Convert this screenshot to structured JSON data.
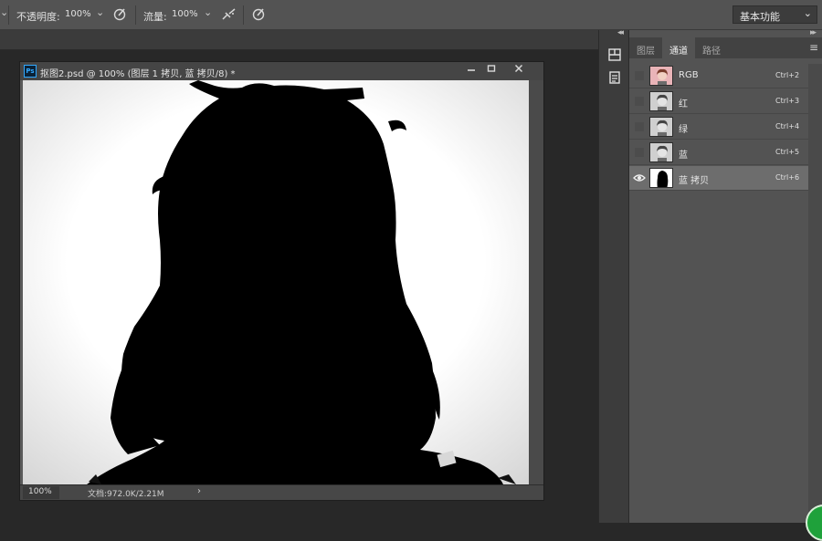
{
  "options": {
    "opacity_label": "不透明度:",
    "opacity_value": "100%",
    "flow_label": "流量:",
    "flow_value": "100%",
    "workspace": "基本功能"
  },
  "document": {
    "title": "抠图2.psd @ 100% (图层 1 拷贝, 蓝 拷贝/8) *",
    "app_icon": "Ps",
    "minimize_icon": "minimize-icon",
    "maximize_icon": "maximize-icon",
    "close_icon": "close-icon",
    "zoom": "100%",
    "doc_info": "文档:972.0K/2.21M",
    "more_icon": "›"
  },
  "panel": {
    "tabs": [
      "图层",
      "通道",
      "路径"
    ],
    "active_tab": "通道",
    "channels": [
      {
        "name": "RGB",
        "shortcut": "Ctrl+2",
        "visible": false,
        "selected": false,
        "thumb": "color"
      },
      {
        "name": "红",
        "shortcut": "Ctrl+3",
        "visible": false,
        "selected": false,
        "thumb": "gray"
      },
      {
        "name": "绿",
        "shortcut": "Ctrl+4",
        "visible": false,
        "selected": false,
        "thumb": "gray"
      },
      {
        "name": "蓝",
        "shortcut": "Ctrl+5",
        "visible": false,
        "selected": false,
        "thumb": "gray"
      },
      {
        "name": "蓝 拷贝",
        "shortcut": "Ctrl+6",
        "visible": true,
        "selected": true,
        "thumb": "mask"
      }
    ]
  },
  "colors": {
    "selected_row": "#6d6d6d",
    "panel_bg": "#535353",
    "ps_blue": "#31a8ff"
  }
}
